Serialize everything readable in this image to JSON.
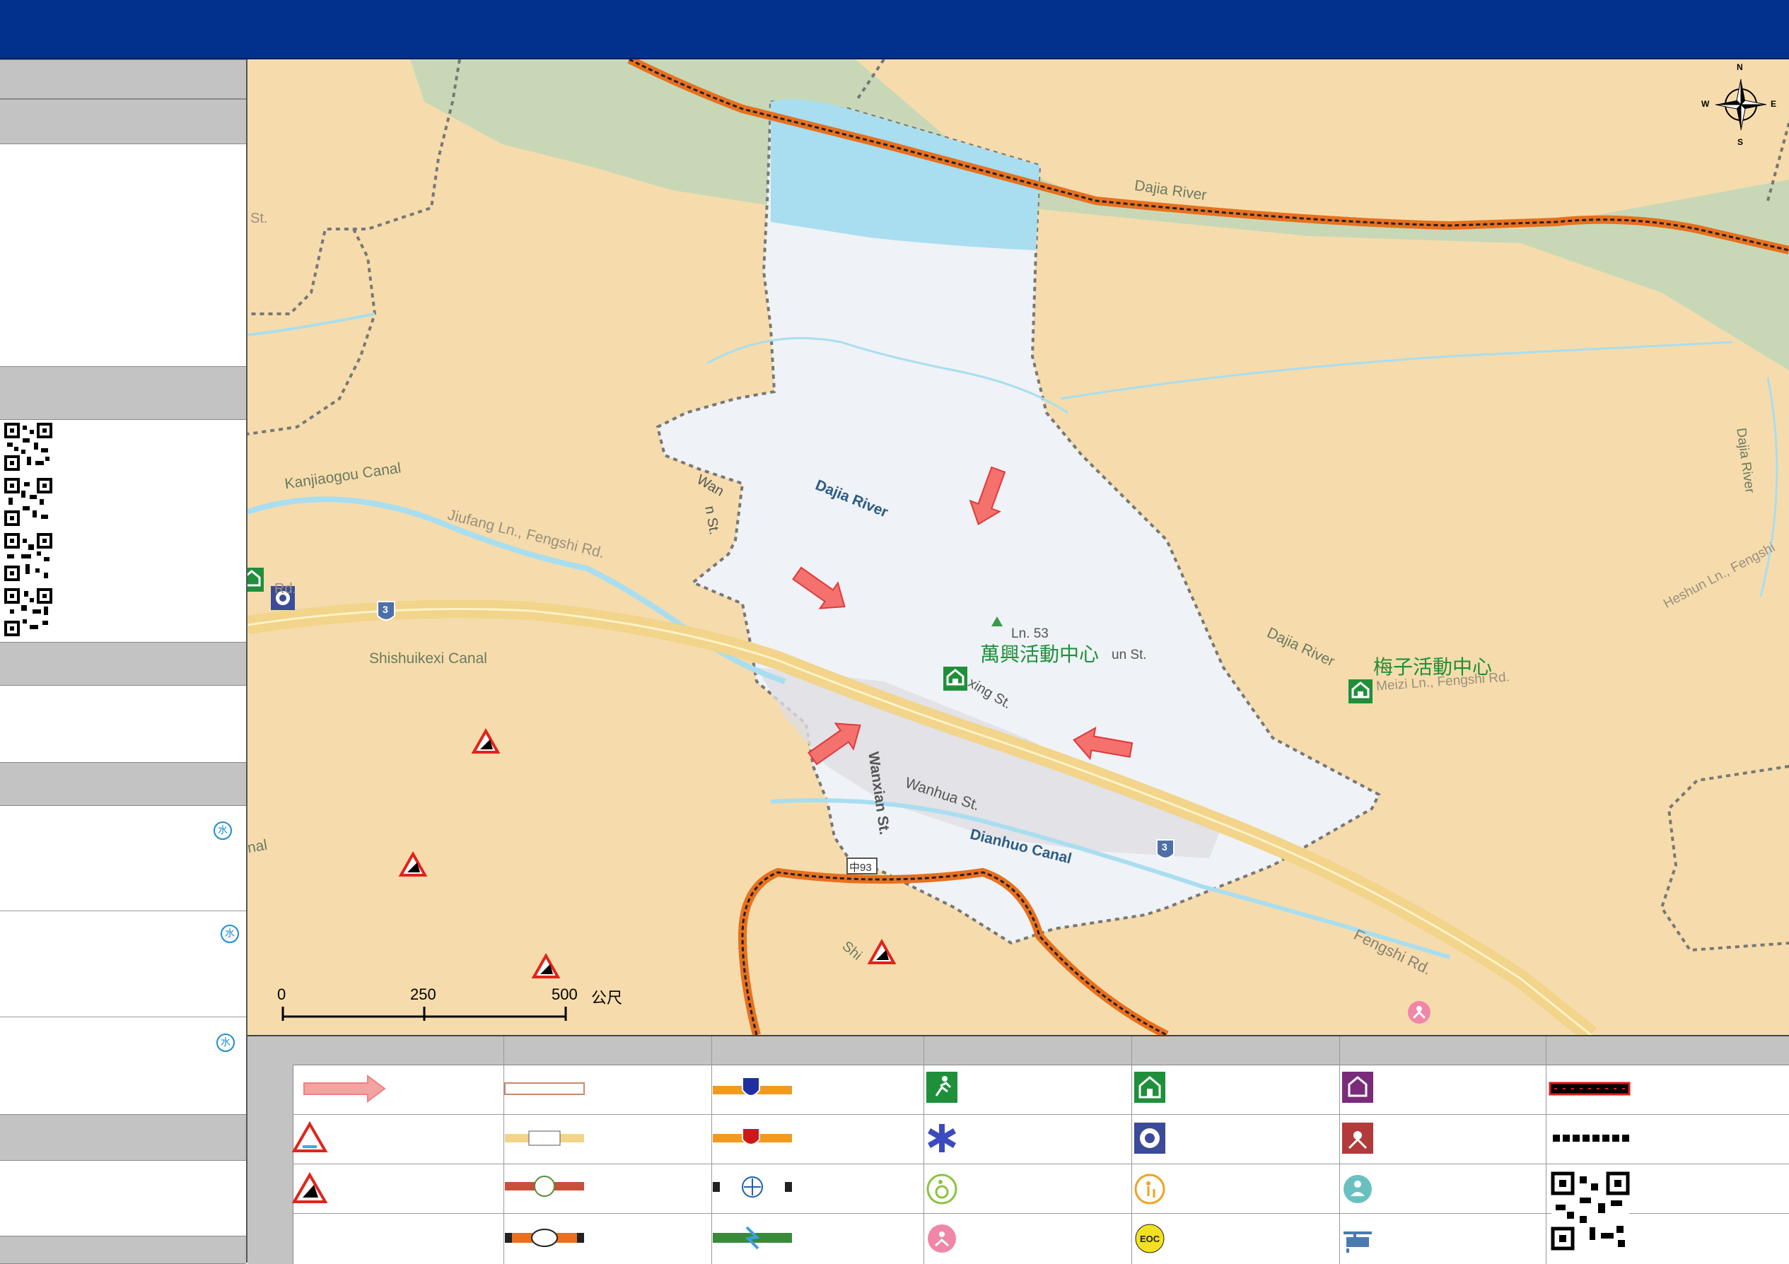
{
  "map": {
    "labels": {
      "dajia_river_north": "Dajia River",
      "dajia_river_center": "Dajia River",
      "dajia_river_east": "Dajia River",
      "dajia_river_far_east": "Dajia River",
      "kanjiaogou_canal": "Kanjiaogou Canal",
      "jiufang_ln": "Jiufang Ln., Fengshi Rd.",
      "shishuikexi_canal": "Shishuikexi Canal",
      "dianhuo_canal": "Dianhuo Canal",
      "wanhua_st": "Wanhua St.",
      "wanxian_st": "Wanxian St.",
      "fengshi_rd": "Fengshi Rd.",
      "heshun_ln": "Heshun Ln., Fengshi",
      "meizi_ln": "Meizi Ln., Fengshi Rd.",
      "ln53": "Ln. 53",
      "un_st": "un St.",
      "xing_st": "xing St.",
      "wan_partial": "Wan",
      "n_st_partial": "n St.",
      "st_partial_left": "St.",
      "rd_partial": "Rd.",
      "nal_partial": "nal",
      "shi_partial": "Shi",
      "route3": "3",
      "zhong93": "中93"
    },
    "shelters": {
      "wanxing": "萬興活動中心",
      "meizi": "梅子活動中心"
    },
    "compass": {
      "n": "N",
      "s": "S",
      "e": "E",
      "w": "W"
    },
    "scale": {
      "t0": "0",
      "t250": "250",
      "t500": "500",
      "unit": "公尺"
    }
  },
  "sidebar": {
    "water_badges": [
      "水",
      "水",
      "水"
    ]
  },
  "legend": {
    "eoc_label": "EOC"
  },
  "colors": {
    "header": "#00318c",
    "land": "#f6dcac",
    "river_band": "#c8d8b7",
    "water": "#a8def0",
    "village": "#eff2f6",
    "highway": "#f2d48a",
    "railway": "#e8701e",
    "arrow": "#f4716e",
    "shelter_green": "#1f8f3a"
  },
  "icons": [
    "compass-rose-icon",
    "shelter-icon",
    "police-icon",
    "landslide-icon",
    "flood-icon",
    "ambulance-icon",
    "wheelchair-icon",
    "elderly-icon",
    "caregiver-icon",
    "family-care-icon",
    "eoc-icon",
    "helicopter-icon",
    "qr-code-icon",
    "evacuation-arrow-icon"
  ]
}
